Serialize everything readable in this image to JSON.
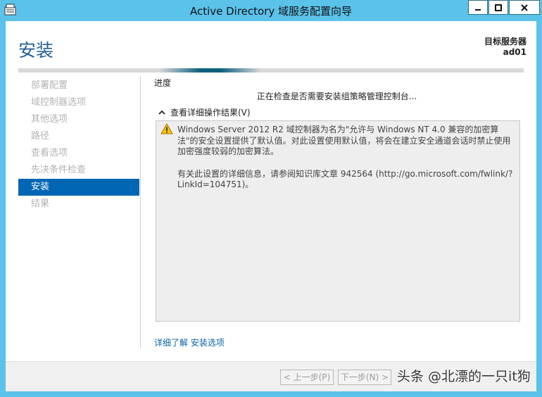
{
  "window": {
    "title": "Active Directory 域服务配置向导",
    "controls": {
      "minimize": "–",
      "maximize": "□",
      "close": "✕"
    }
  },
  "header": {
    "page_title": "安装",
    "server_caption": "目标服务器",
    "server_name": "ad01"
  },
  "nav": {
    "items": [
      {
        "label": "部署配置",
        "active": false
      },
      {
        "label": "域控制器选项",
        "active": false
      },
      {
        "label": "其他选项",
        "active": false
      },
      {
        "label": "路径",
        "active": false
      },
      {
        "label": "查看选项",
        "active": false
      },
      {
        "label": "先决条件检查",
        "active": false
      },
      {
        "label": "安装",
        "active": true
      },
      {
        "label": "结果",
        "active": false
      }
    ]
  },
  "main": {
    "section_heading": "进度",
    "status_text": "正在检查是否需要安装组策略管理控制台...",
    "details_toggle": "查看详细操作结果(V)",
    "details": {
      "warning_icon": "warning-icon",
      "paragraph1": "Windows Server 2012 R2 域控制器为名为\"允许与 Windows NT 4.0 兼容的加密算法\"的安全设置提供了默认值。对此设置使用默认值，将会在建立安全通道会话时禁止使用加密强度较弱的加密算法。",
      "paragraph2": "有关此设置的详细信息，请参阅知识库文章 942564 (http://go.microsoft.com/fwlink/?LinkId=104751)。"
    },
    "learn_more": "详细了解 安装选项"
  },
  "footer": {
    "prev_label": "< 上一步(P)",
    "next_label": "下一步(N) >"
  },
  "watermark": "头条 @北漂的一只it狗",
  "colors": {
    "frame": "#5bc2ea",
    "accent": "#0066b4",
    "title": "#1f5f9a",
    "link": "#0b63a6",
    "disabled": "#b3b3b3"
  }
}
